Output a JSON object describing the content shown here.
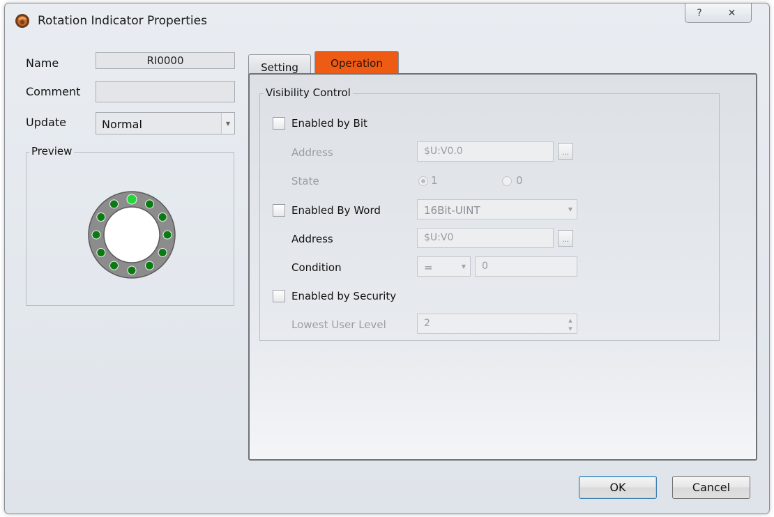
{
  "window": {
    "title": "Rotation Indicator Properties",
    "help_symbol": "?",
    "close_symbol": "✕"
  },
  "left": {
    "name_label": "Name",
    "name_value": "RI0000",
    "comment_label": "Comment",
    "comment_value": "",
    "update_label": "Update",
    "update_value": "Normal",
    "preview_label": "Preview"
  },
  "tabs": {
    "setting": "Setting",
    "operation": "Operation"
  },
  "operation": {
    "group_label": "Visibility Control",
    "enabled_by_bit": {
      "label": "Enabled by Bit",
      "checked": false,
      "address_label": "Address",
      "address_value": "$U:V0.0",
      "state_label": "State",
      "state_option_1": "1",
      "state_option_0": "0",
      "state_selected": "1"
    },
    "enabled_by_word": {
      "label": "Enabled By Word",
      "checked": false,
      "type_value": "16Bit-UINT",
      "address_label": "Address",
      "address_value": "$U:V0",
      "condition_label": "Condition",
      "condition_operator": "=",
      "condition_value": "0"
    },
    "enabled_by_security": {
      "label": "Enabled by Security",
      "checked": false,
      "lowest_level_label": "Lowest User Level",
      "lowest_level_value": "2"
    }
  },
  "buttons": {
    "ok": "OK",
    "cancel": "Cancel",
    "ellipsis": "..."
  },
  "colors": {
    "operation_tab": "#ee5b14",
    "led_on": "#22d63a",
    "led_off": "#0b7a12",
    "ring": "#8c8c8c"
  },
  "preview_indicator": {
    "led_count": 12,
    "active_index": 0
  }
}
